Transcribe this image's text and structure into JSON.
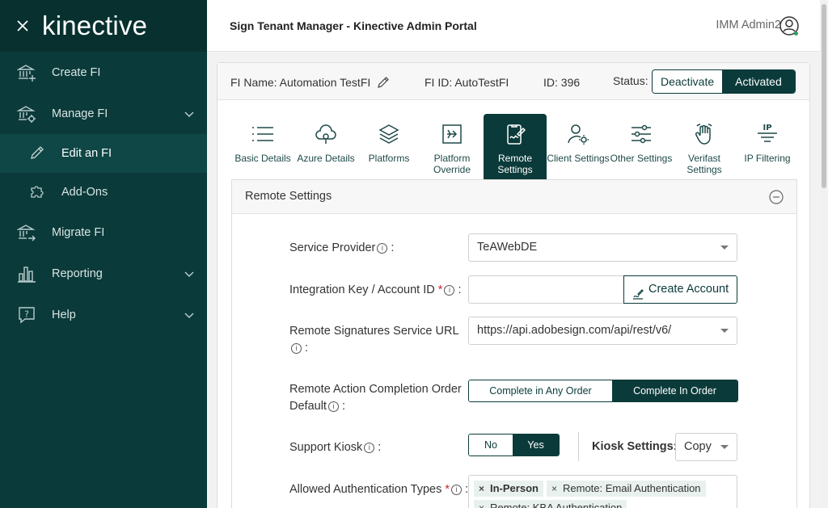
{
  "sidebar": {
    "logo": "kinective",
    "items": [
      {
        "label": "Create FI"
      },
      {
        "label": "Manage FI"
      },
      {
        "label": "Edit an FI"
      },
      {
        "label": "Add-Ons"
      },
      {
        "label": "Migrate FI"
      },
      {
        "label": "Reporting"
      },
      {
        "label": "Help"
      }
    ]
  },
  "header": {
    "title": "Sign Tenant Manager - Kinective Admin Portal",
    "user": "IMM Admin2"
  },
  "fi": {
    "name": "FI Name: Automation TestFI",
    "fi_id": "FI ID: AutoTestFI",
    "id": "ID: 396",
    "status_label": "Status:",
    "deactivate": "Deactivate",
    "activated": "Activated"
  },
  "tabs": [
    {
      "label": "Basic Details",
      "icon": "list-icon"
    },
    {
      "label": "Azure Details",
      "icon": "cloud-icon"
    },
    {
      "label": "Platforms",
      "icon": "layers-icon"
    },
    {
      "label": "Platform Override",
      "icon": "override-icon"
    },
    {
      "label": "Remote Settings",
      "icon": "remote-sign-icon"
    },
    {
      "label": "Client Settings",
      "icon": "user-gear-icon"
    },
    {
      "label": "Other Settings",
      "icon": "sliders-icon"
    },
    {
      "label": "Verifast Settings",
      "icon": "hand-icon"
    },
    {
      "label": "IP Filtering",
      "icon": "ip-filter-icon"
    }
  ],
  "remote": {
    "section_title": "Remote Settings",
    "service_provider_label": "Service Provider",
    "service_provider_value": "TeAWebDE",
    "integration_label": "Integration Key / Account ID",
    "integration_value": "",
    "create_account": "Create Account",
    "url_label": "Remote Signatures Service URL",
    "url_value": "https://api.adobesign.com/api/rest/v6/",
    "order_label_line1": "Remote Action Completion Order",
    "order_label_line2": "Default",
    "order_any": "Complete in Any Order",
    "order_in": "Complete In Order",
    "kiosk_label": "Support Kiosk",
    "kiosk_no": "No",
    "kiosk_yes": "Yes",
    "kiosk_settings_label": "Kiosk Settings:",
    "kiosk_settings_value": "Copy",
    "auth_label": "Allowed Authentication Types",
    "auth_chips": [
      "In-Person",
      "Remote: Email Authentication",
      "Remote: KBA Authentication"
    ]
  }
}
